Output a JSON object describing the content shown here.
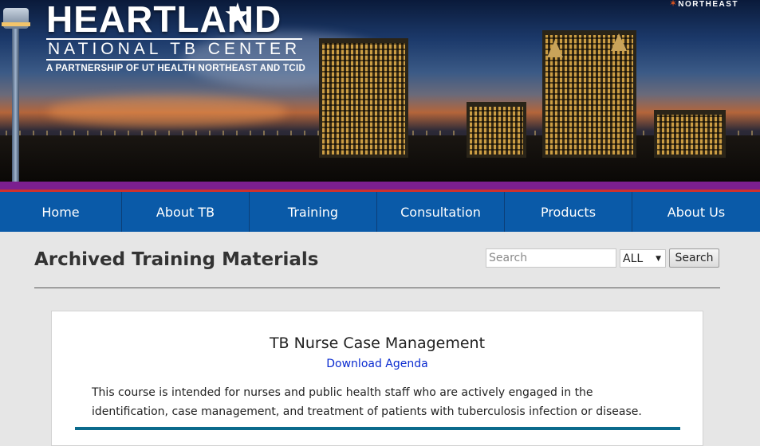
{
  "banner": {
    "logo_title": "HEARTLAND",
    "logo_subtitle": "NATIONAL TB CENTER",
    "logo_tagline": "A PARTNERSHIP OF UT HEALTH NORTHEAST AND TCID",
    "partner_text": "NORTHEAST",
    "star_icon": "star-icon"
  },
  "nav": {
    "items": [
      {
        "label": "Home"
      },
      {
        "label": "About TB"
      },
      {
        "label": "Training"
      },
      {
        "label": "Consultation"
      },
      {
        "label": "Products"
      },
      {
        "label": "About Us"
      }
    ]
  },
  "page": {
    "title": "Archived Training Materials"
  },
  "search": {
    "placeholder": "Search",
    "value": "",
    "scope_selected": "ALL",
    "button_label": "Search"
  },
  "course": {
    "title": "TB Nurse Case Management",
    "link_label": "Download Agenda",
    "description": "This course is intended for nurses and public health staff who are actively engaged in the identification, case management, and treatment of patients with tuberculosis infection or disease."
  },
  "colors": {
    "nav_bg": "#0a5aa8",
    "stripe_purple": "#7b1f8f",
    "stripe_red": "#d0312d",
    "link": "#0a2bd0",
    "card_rule": "#0b6a8c"
  }
}
